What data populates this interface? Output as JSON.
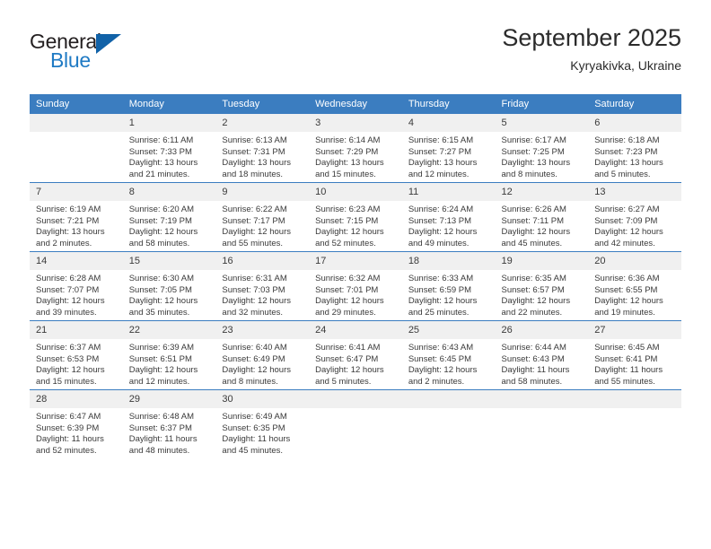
{
  "brand": {
    "name_top": "General",
    "name_bottom": "Blue",
    "triangle_color": "#1162a8",
    "blue_color": "#1f7ac4"
  },
  "header": {
    "title": "September 2025",
    "subtitle": "Kyryakivka, Ukraine"
  },
  "theme": {
    "header_bg": "#3b7dc0",
    "daynum_bg": "#f0f0f0",
    "row_divider": "#3b7dc0",
    "text": "#3a3a3a"
  },
  "weekday_headers": [
    "Sunday",
    "Monday",
    "Tuesday",
    "Wednesday",
    "Thursday",
    "Friday",
    "Saturday"
  ],
  "labels": {
    "sunrise_prefix": "Sunrise:",
    "sunset_prefix": "Sunset:",
    "daylight_prefix": "Daylight:"
  },
  "weeks": [
    [
      {
        "day": "",
        "empty": true,
        "line1": "",
        "line2": "",
        "line3": "",
        "line4": ""
      },
      {
        "day": "1",
        "line1": "Sunrise: 6:11 AM",
        "line2": "Sunset: 7:33 PM",
        "line3": "Daylight: 13 hours",
        "line4": "and 21 minutes."
      },
      {
        "day": "2",
        "line1": "Sunrise: 6:13 AM",
        "line2": "Sunset: 7:31 PM",
        "line3": "Daylight: 13 hours",
        "line4": "and 18 minutes."
      },
      {
        "day": "3",
        "line1": "Sunrise: 6:14 AM",
        "line2": "Sunset: 7:29 PM",
        "line3": "Daylight: 13 hours",
        "line4": "and 15 minutes."
      },
      {
        "day": "4",
        "line1": "Sunrise: 6:15 AM",
        "line2": "Sunset: 7:27 PM",
        "line3": "Daylight: 13 hours",
        "line4": "and 12 minutes."
      },
      {
        "day": "5",
        "line1": "Sunrise: 6:17 AM",
        "line2": "Sunset: 7:25 PM",
        "line3": "Daylight: 13 hours",
        "line4": "and 8 minutes."
      },
      {
        "day": "6",
        "line1": "Sunrise: 6:18 AM",
        "line2": "Sunset: 7:23 PM",
        "line3": "Daylight: 13 hours",
        "line4": "and 5 minutes."
      }
    ],
    [
      {
        "day": "7",
        "line1": "Sunrise: 6:19 AM",
        "line2": "Sunset: 7:21 PM",
        "line3": "Daylight: 13 hours",
        "line4": "and 2 minutes."
      },
      {
        "day": "8",
        "line1": "Sunrise: 6:20 AM",
        "line2": "Sunset: 7:19 PM",
        "line3": "Daylight: 12 hours",
        "line4": "and 58 minutes."
      },
      {
        "day": "9",
        "line1": "Sunrise: 6:22 AM",
        "line2": "Sunset: 7:17 PM",
        "line3": "Daylight: 12 hours",
        "line4": "and 55 minutes."
      },
      {
        "day": "10",
        "line1": "Sunrise: 6:23 AM",
        "line2": "Sunset: 7:15 PM",
        "line3": "Daylight: 12 hours",
        "line4": "and 52 minutes."
      },
      {
        "day": "11",
        "line1": "Sunrise: 6:24 AM",
        "line2": "Sunset: 7:13 PM",
        "line3": "Daylight: 12 hours",
        "line4": "and 49 minutes."
      },
      {
        "day": "12",
        "line1": "Sunrise: 6:26 AM",
        "line2": "Sunset: 7:11 PM",
        "line3": "Daylight: 12 hours",
        "line4": "and 45 minutes."
      },
      {
        "day": "13",
        "line1": "Sunrise: 6:27 AM",
        "line2": "Sunset: 7:09 PM",
        "line3": "Daylight: 12 hours",
        "line4": "and 42 minutes."
      }
    ],
    [
      {
        "day": "14",
        "line1": "Sunrise: 6:28 AM",
        "line2": "Sunset: 7:07 PM",
        "line3": "Daylight: 12 hours",
        "line4": "and 39 minutes."
      },
      {
        "day": "15",
        "line1": "Sunrise: 6:30 AM",
        "line2": "Sunset: 7:05 PM",
        "line3": "Daylight: 12 hours",
        "line4": "and 35 minutes."
      },
      {
        "day": "16",
        "line1": "Sunrise: 6:31 AM",
        "line2": "Sunset: 7:03 PM",
        "line3": "Daylight: 12 hours",
        "line4": "and 32 minutes."
      },
      {
        "day": "17",
        "line1": "Sunrise: 6:32 AM",
        "line2": "Sunset: 7:01 PM",
        "line3": "Daylight: 12 hours",
        "line4": "and 29 minutes."
      },
      {
        "day": "18",
        "line1": "Sunrise: 6:33 AM",
        "line2": "Sunset: 6:59 PM",
        "line3": "Daylight: 12 hours",
        "line4": "and 25 minutes."
      },
      {
        "day": "19",
        "line1": "Sunrise: 6:35 AM",
        "line2": "Sunset: 6:57 PM",
        "line3": "Daylight: 12 hours",
        "line4": "and 22 minutes."
      },
      {
        "day": "20",
        "line1": "Sunrise: 6:36 AM",
        "line2": "Sunset: 6:55 PM",
        "line3": "Daylight: 12 hours",
        "line4": "and 19 minutes."
      }
    ],
    [
      {
        "day": "21",
        "line1": "Sunrise: 6:37 AM",
        "line2": "Sunset: 6:53 PM",
        "line3": "Daylight: 12 hours",
        "line4": "and 15 minutes."
      },
      {
        "day": "22",
        "line1": "Sunrise: 6:39 AM",
        "line2": "Sunset: 6:51 PM",
        "line3": "Daylight: 12 hours",
        "line4": "and 12 minutes."
      },
      {
        "day": "23",
        "line1": "Sunrise: 6:40 AM",
        "line2": "Sunset: 6:49 PM",
        "line3": "Daylight: 12 hours",
        "line4": "and 8 minutes."
      },
      {
        "day": "24",
        "line1": "Sunrise: 6:41 AM",
        "line2": "Sunset: 6:47 PM",
        "line3": "Daylight: 12 hours",
        "line4": "and 5 minutes."
      },
      {
        "day": "25",
        "line1": "Sunrise: 6:43 AM",
        "line2": "Sunset: 6:45 PM",
        "line3": "Daylight: 12 hours",
        "line4": "and 2 minutes."
      },
      {
        "day": "26",
        "line1": "Sunrise: 6:44 AM",
        "line2": "Sunset: 6:43 PM",
        "line3": "Daylight: 11 hours",
        "line4": "and 58 minutes."
      },
      {
        "day": "27",
        "line1": "Sunrise: 6:45 AM",
        "line2": "Sunset: 6:41 PM",
        "line3": "Daylight: 11 hours",
        "line4": "and 55 minutes."
      }
    ],
    [
      {
        "day": "28",
        "line1": "Sunrise: 6:47 AM",
        "line2": "Sunset: 6:39 PM",
        "line3": "Daylight: 11 hours",
        "line4": "and 52 minutes."
      },
      {
        "day": "29",
        "line1": "Sunrise: 6:48 AM",
        "line2": "Sunset: 6:37 PM",
        "line3": "Daylight: 11 hours",
        "line4": "and 48 minutes."
      },
      {
        "day": "30",
        "line1": "Sunrise: 6:49 AM",
        "line2": "Sunset: 6:35 PM",
        "line3": "Daylight: 11 hours",
        "line4": "and 45 minutes."
      },
      {
        "day": "",
        "empty": true,
        "line1": "",
        "line2": "",
        "line3": "",
        "line4": ""
      },
      {
        "day": "",
        "empty": true,
        "line1": "",
        "line2": "",
        "line3": "",
        "line4": ""
      },
      {
        "day": "",
        "empty": true,
        "line1": "",
        "line2": "",
        "line3": "",
        "line4": ""
      },
      {
        "day": "",
        "empty": true,
        "line1": "",
        "line2": "",
        "line3": "",
        "line4": ""
      }
    ]
  ]
}
